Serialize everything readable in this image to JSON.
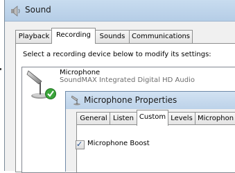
{
  "sound_window": {
    "title": "Sound",
    "icon": "speaker-icon",
    "tabs": [
      "Playback",
      "Recording",
      "Sounds",
      "Communications"
    ],
    "selected_tab": "Recording",
    "instruction": "Select a recording device below to modify its settings:",
    "devices": [
      {
        "name": "Microphone",
        "description": "SoundMAX Integrated Digital HD Audio",
        "icon": "microphone-icon",
        "status": "default-device-check-icon"
      }
    ]
  },
  "properties_dialog": {
    "title": "Microphone Properties",
    "icon": "microphone-icon",
    "tabs": [
      "General",
      "Listen",
      "Custom",
      "Levels",
      "Microphon"
    ],
    "selected_tab": "Custom",
    "microphone_boost": {
      "label": "Microphone Boost",
      "checked": true
    }
  },
  "colors": {
    "titlebar": "#c8dcef",
    "check_green": "#3aa53a"
  }
}
